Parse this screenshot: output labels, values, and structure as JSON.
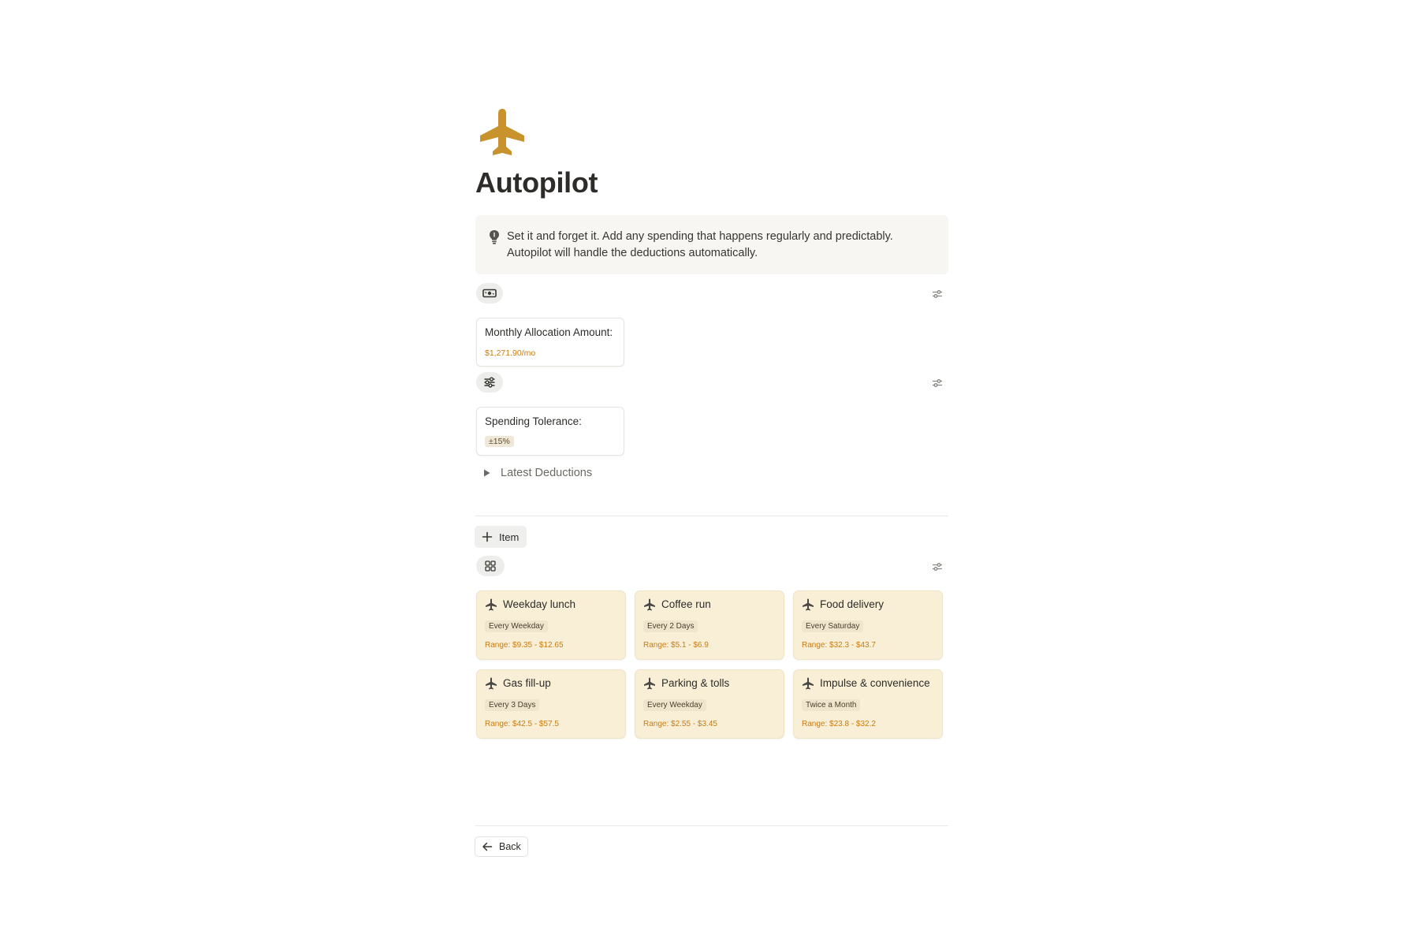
{
  "page": {
    "icon": "airplane-icon",
    "title": "Autopilot",
    "accent_color": "#c8922c"
  },
  "callout": {
    "icon": "lightbulb-icon",
    "text": "Set it and forget it. Add any spending that happens regularly and predictably. Autopilot will handle the deductions automatically."
  },
  "allocation": {
    "view_icon": "money-icon",
    "label": "Monthly Allocation Amount:",
    "value": "$1,271.90/mo"
  },
  "tolerance": {
    "view_icon": "sliders-icon",
    "label": "Spending Tolerance:",
    "value": "±15%"
  },
  "toggle": {
    "label": "Latest Deductions",
    "expanded": false
  },
  "new_item": {
    "label": "Item"
  },
  "gallery": {
    "view_icon": "grid-icon",
    "items": [
      {
        "title": "Weekday lunch",
        "frequency": "Every Weekday",
        "range": "Range: $9.35 - $12.65"
      },
      {
        "title": "Coffee run",
        "frequency": "Every 2 Days",
        "range": "Range: $5.1 - $6.9"
      },
      {
        "title": "Food delivery",
        "frequency": "Every Saturday",
        "range": "Range: $32.3 - $43.7"
      },
      {
        "title": "Gas fill-up",
        "frequency": "Every 3 Days",
        "range": "Range: $42.5 - $57.5"
      },
      {
        "title": "Parking & tolls",
        "frequency": "Every Weekday",
        "range": "Range: $2.55 - $3.45"
      },
      {
        "title": "Impulse & convenience",
        "frequency": "Twice a Month",
        "range": "Range: $23.8 - $32.2"
      }
    ]
  },
  "back": {
    "label": "Back"
  },
  "colors": {
    "card_background": "#f8efd6",
    "range_text": "#c97c12",
    "callout_background": "#f7f6f3"
  }
}
